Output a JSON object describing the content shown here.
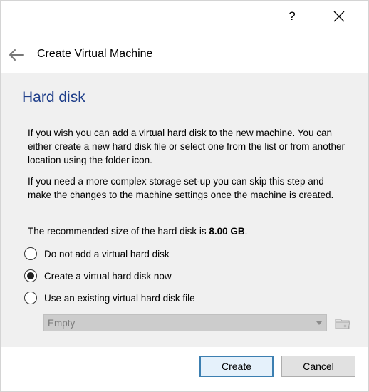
{
  "titlebar": {
    "help_label": "?",
    "close_icon": "close-icon"
  },
  "header": {
    "back_icon": "back-arrow-icon",
    "title": "Create Virtual Machine"
  },
  "page": {
    "title": "Hard disk",
    "paragraph1": "If you wish you can add a virtual hard disk to the new machine. You can either create a new hard disk file or select one from the list or from another location using the folder icon.",
    "paragraph2": "If you need a more complex storage set-up you can skip this step and make the changes to the machine settings once the machine is created.",
    "recommended_prefix": "The recommended size of the hard disk is ",
    "recommended_size": "8.00 GB",
    "recommended_suffix": "."
  },
  "options": [
    {
      "label": "Do not add a virtual hard disk",
      "selected": false
    },
    {
      "label": "Create a virtual hard disk now",
      "selected": true
    },
    {
      "label": "Use an existing virtual hard disk file",
      "selected": false
    }
  ],
  "disk_select": {
    "value": "Empty",
    "enabled": false
  },
  "buttons": {
    "create": "Create",
    "cancel": "Cancel"
  },
  "colors": {
    "title_blue": "#1e3e8a",
    "panel_bg": "#f0f0f0",
    "default_button_border": "#3c7fb1"
  }
}
